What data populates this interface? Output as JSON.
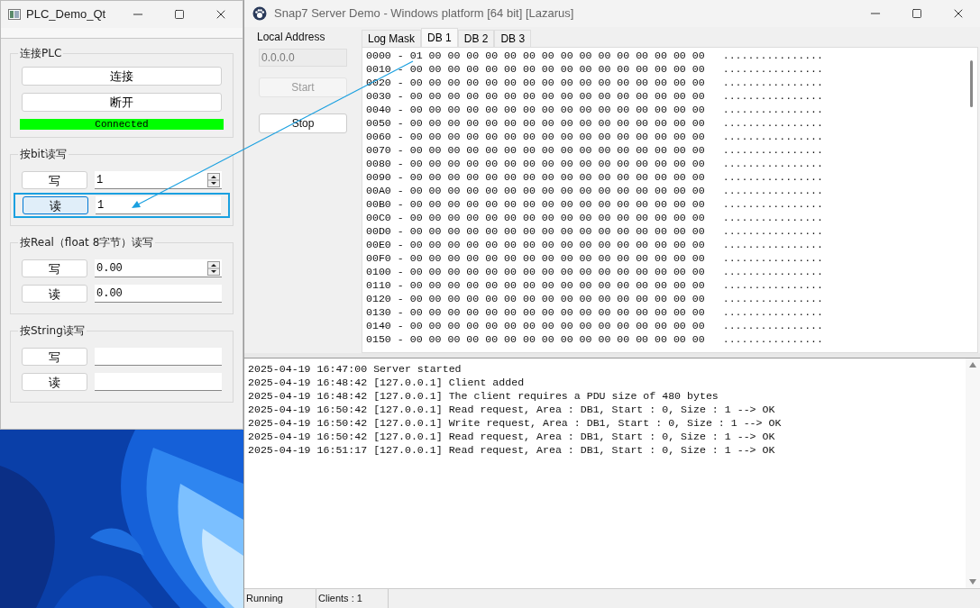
{
  "plc_window": {
    "title": "PLC_Demo_Qt",
    "groups": [
      {
        "title": "连接PLC",
        "buttons": [
          "连接",
          "断开"
        ],
        "status": {
          "text": "Connected",
          "connected": true
        }
      },
      {
        "title": "按bit读写",
        "rows": [
          {
            "button": "写",
            "kind": "spin",
            "value": "1",
            "highlighted": false
          },
          {
            "button": "读",
            "kind": "field",
            "value": "1",
            "highlighted": true
          }
        ]
      },
      {
        "title": "按Real（float 8字节）读写",
        "rows": [
          {
            "button": "写",
            "kind": "spin",
            "value": "0.00",
            "highlighted": false
          },
          {
            "button": "读",
            "kind": "field",
            "value": "0.00",
            "highlighted": false
          }
        ]
      },
      {
        "title": "按String读写",
        "rows": [
          {
            "button": "写",
            "kind": "field",
            "highlighted": false
          },
          {
            "button": "读",
            "kind": "field",
            "highlighted": false
          }
        ]
      }
    ]
  },
  "server_window": {
    "title": "Snap7 Server Demo - Windows platform [64 bit] [Lazarus]",
    "local_address": {
      "label": "Local Address",
      "value": "0.0.0.0"
    },
    "buttons": [
      {
        "label": "Start",
        "disabled": true
      },
      {
        "label": "Stop",
        "disabled": false
      }
    ],
    "tabs": [
      {
        "label": "Log Mask",
        "selected": false
      },
      {
        "label": "DB 1",
        "selected": true
      },
      {
        "label": "DB 2",
        "selected": false
      },
      {
        "label": "DB 3",
        "selected": false
      }
    ],
    "hex_rows": [
      {
        "line": "0000 - 01 00 00 00 00 00 00 00 00 00 00 00 00 00 00 00",
        "ascii": "................"
      },
      {
        "line": "0010 - 00 00 00 00 00 00 00 00 00 00 00 00 00 00 00 00",
        "ascii": "................"
      },
      {
        "line": "0020 - 00 00 00 00 00 00 00 00 00 00 00 00 00 00 00 00",
        "ascii": "................"
      },
      {
        "line": "0030 - 00 00 00 00 00 00 00 00 00 00 00 00 00 00 00 00",
        "ascii": "................"
      },
      {
        "line": "0040 - 00 00 00 00 00 00 00 00 00 00 00 00 00 00 00 00",
        "ascii": "................"
      },
      {
        "line": "0050 - 00 00 00 00 00 00 00 00 00 00 00 00 00 00 00 00",
        "ascii": "................"
      },
      {
        "line": "0060 - 00 00 00 00 00 00 00 00 00 00 00 00 00 00 00 00",
        "ascii": "................"
      },
      {
        "line": "0070 - 00 00 00 00 00 00 00 00 00 00 00 00 00 00 00 00",
        "ascii": "................"
      },
      {
        "line": "0080 - 00 00 00 00 00 00 00 00 00 00 00 00 00 00 00 00",
        "ascii": "................"
      },
      {
        "line": "0090 - 00 00 00 00 00 00 00 00 00 00 00 00 00 00 00 00",
        "ascii": "................"
      },
      {
        "line": "00A0 - 00 00 00 00 00 00 00 00 00 00 00 00 00 00 00 00",
        "ascii": "................"
      },
      {
        "line": "00B0 - 00 00 00 00 00 00 00 00 00 00 00 00 00 00 00 00",
        "ascii": "................"
      },
      {
        "line": "00C0 - 00 00 00 00 00 00 00 00 00 00 00 00 00 00 00 00",
        "ascii": "................"
      },
      {
        "line": "00D0 - 00 00 00 00 00 00 00 00 00 00 00 00 00 00 00 00",
        "ascii": "................"
      },
      {
        "line": "00E0 - 00 00 00 00 00 00 00 00 00 00 00 00 00 00 00 00",
        "ascii": "................"
      },
      {
        "line": "00F0 - 00 00 00 00 00 00 00 00 00 00 00 00 00 00 00 00",
        "ascii": "................"
      },
      {
        "line": "0100 - 00 00 00 00 00 00 00 00 00 00 00 00 00 00 00 00",
        "ascii": "................"
      },
      {
        "line": "0110 - 00 00 00 00 00 00 00 00 00 00 00 00 00 00 00 00",
        "ascii": "................"
      },
      {
        "line": "0120 - 00 00 00 00 00 00 00 00 00 00 00 00 00 00 00 00",
        "ascii": "................"
      },
      {
        "line": "0130 - 00 00 00 00 00 00 00 00 00 00 00 00 00 00 00 00",
        "ascii": "................"
      },
      {
        "line": "0140 - 00 00 00 00 00 00 00 00 00 00 00 00 00 00 00 00",
        "ascii": "................"
      },
      {
        "line": "0150 - 00 00 00 00 00 00 00 00 00 00 00 00 00 00 00 00",
        "ascii": "................"
      }
    ],
    "log": [
      "2025-04-19 16:47:00 Server started",
      "2025-04-19 16:48:42 [127.0.0.1] Client added",
      "2025-04-19 16:48:42 [127.0.0.1] The client requires a PDU size of 480 bytes",
      "2025-04-19 16:50:42 [127.0.0.1] Read request, Area : DB1, Start : 0, Size : 1 --> OK",
      "2025-04-19 16:50:42 [127.0.0.1] Write request, Area : DB1, Start : 0, Size : 1 --> OK",
      "2025-04-19 16:50:42 [127.0.0.1] Read request, Area : DB1, Start : 0, Size : 1 --> OK",
      "2025-04-19 16:51:17 [127.0.0.1] Read request, Area : DB1, Start : 0, Size : 1 --> OK"
    ],
    "status_bar": [
      "Running",
      "Clients : 1"
    ]
  }
}
